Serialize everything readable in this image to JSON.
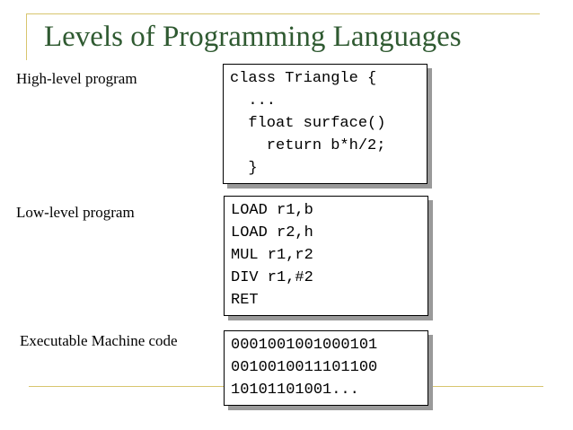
{
  "title": "Levels of Programming Languages",
  "sections": {
    "high": {
      "label": "High-level program",
      "lines": [
        "class Triangle {",
        "  ...",
        "  float surface()",
        "    return b*h/2;",
        "  }"
      ]
    },
    "low": {
      "label": "Low-level program",
      "lines": [
        "LOAD r1,b",
        "LOAD r2,h",
        "MUL r1,r2",
        "DIV r1,#2",
        "RET"
      ]
    },
    "exec": {
      "label": "Executable Machine code",
      "lines": [
        "0001001001000101",
        "0010010011101100",
        "10101101001..."
      ]
    }
  },
  "colors": {
    "title": "#2f5a31",
    "rule": "#d8c56e",
    "shadow": "#9a9a9a"
  }
}
